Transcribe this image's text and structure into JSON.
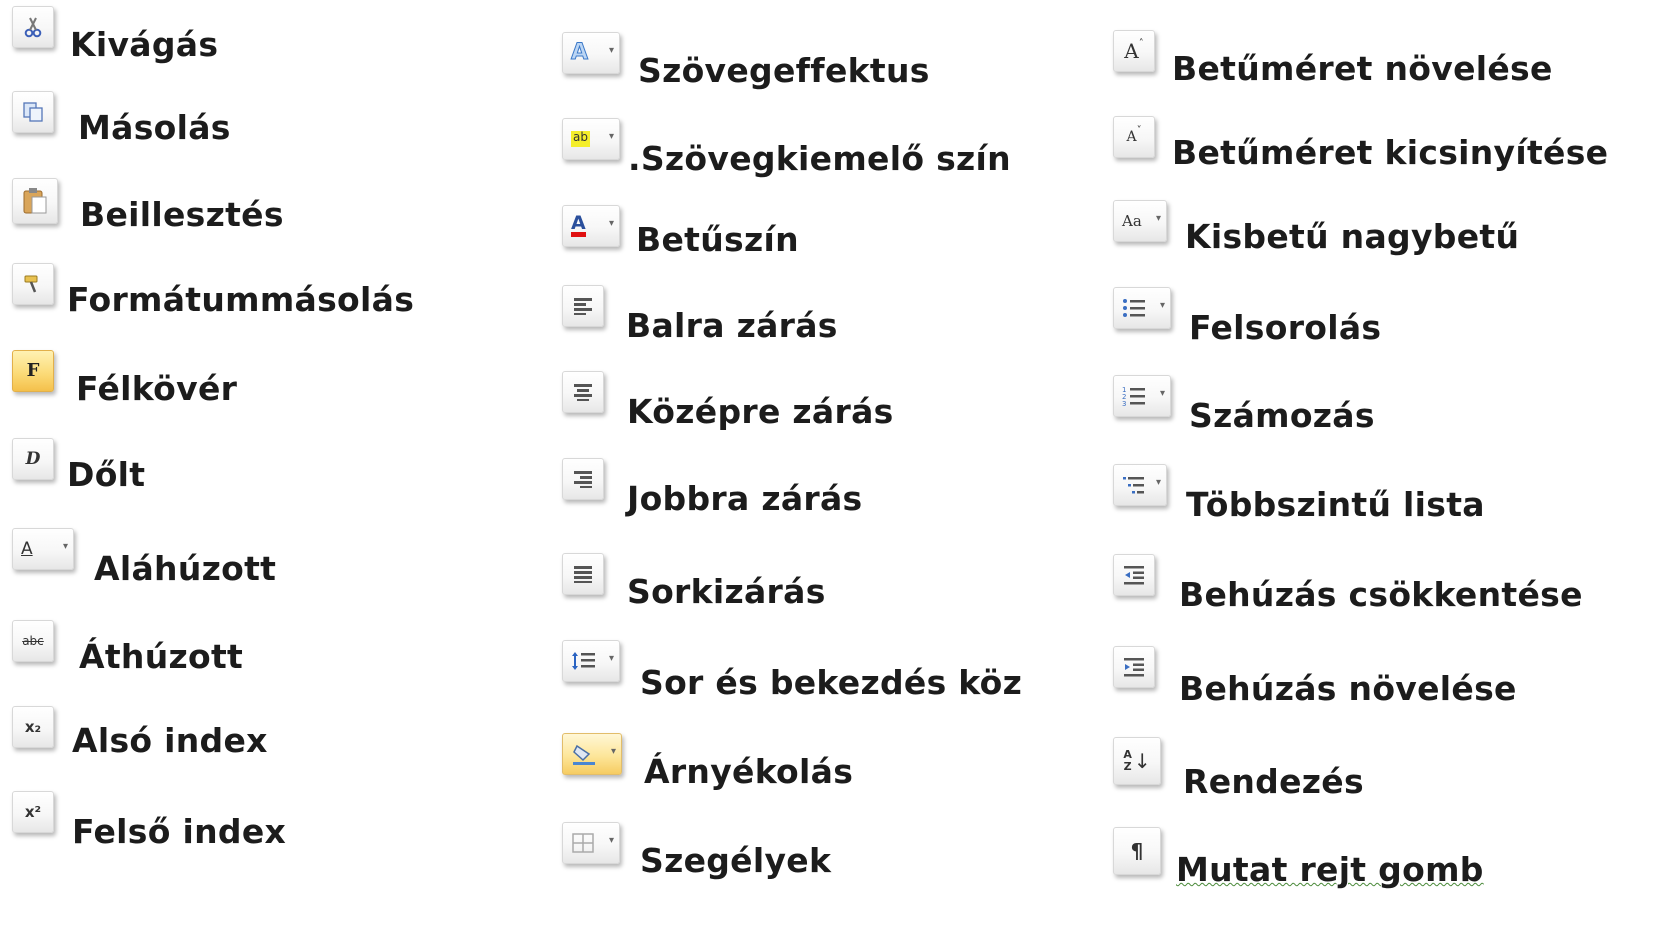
{
  "items": [
    {
      "icon": "scissors-icon",
      "label": "Kivágás"
    },
    {
      "icon": "copy-icon",
      "label": "Másolás"
    },
    {
      "icon": "paste-icon",
      "label": "Beillesztés"
    },
    {
      "icon": "format-painter-icon",
      "label": "Formátummásolás"
    },
    {
      "icon": "bold-icon",
      "label": "Félkövér",
      "glyph": "F"
    },
    {
      "icon": "italic-icon",
      "label": "Dőlt",
      "glyph": "D"
    },
    {
      "icon": "underline-icon",
      "label": "Aláhúzott",
      "glyph": "A"
    },
    {
      "icon": "strikethrough-icon",
      "label": "Áthúzott",
      "glyph": "abc"
    },
    {
      "icon": "subscript-icon",
      "label": "Alsó index",
      "glyph": "x₂"
    },
    {
      "icon": "superscript-icon",
      "label": "Felső index",
      "glyph": "x²"
    },
    {
      "icon": "text-effect-icon",
      "label": "Szövegeffektus",
      "glyph": "A"
    },
    {
      "icon": "highlight-color-icon",
      "label": ".Szövegkiemelő szín",
      "glyph": "ab"
    },
    {
      "icon": "font-color-icon",
      "label": "Betűszín",
      "glyph": "A"
    },
    {
      "icon": "align-left-icon",
      "label": "Balra zárás"
    },
    {
      "icon": "align-center-icon",
      "label": "Középre zárás"
    },
    {
      "icon": "align-right-icon",
      "label": "Jobbra zárás"
    },
    {
      "icon": "justify-icon",
      "label": "Sorkizárás"
    },
    {
      "icon": "line-spacing-icon",
      "label": "Sor és bekezdés köz"
    },
    {
      "icon": "shading-icon",
      "label": "Árnyékolás"
    },
    {
      "icon": "borders-icon",
      "label": "Szegélyek"
    },
    {
      "icon": "grow-font-icon",
      "label": "Betűméret növelése",
      "glyph": "A"
    },
    {
      "icon": "shrink-font-icon",
      "label": "Betűméret kicsinyítése",
      "glyph": "A"
    },
    {
      "icon": "change-case-icon",
      "label": "Kisbetű nagybetű",
      "glyph": "Aa"
    },
    {
      "icon": "bullets-icon",
      "label": "Felsorolás"
    },
    {
      "icon": "numbering-icon",
      "label": "Számozás"
    },
    {
      "icon": "multilevel-list-icon",
      "label": "Többszintű lista"
    },
    {
      "icon": "decrease-indent-icon",
      "label": "Behúzás csökkentése"
    },
    {
      "icon": "increase-indent-icon",
      "label": "Behúzás növelése"
    },
    {
      "icon": "sort-icon",
      "label": "Rendezés",
      "glyph": "AZ"
    },
    {
      "icon": "show-hide-icon",
      "label": "Mutat rejt gomb",
      "glyph": "¶"
    }
  ]
}
